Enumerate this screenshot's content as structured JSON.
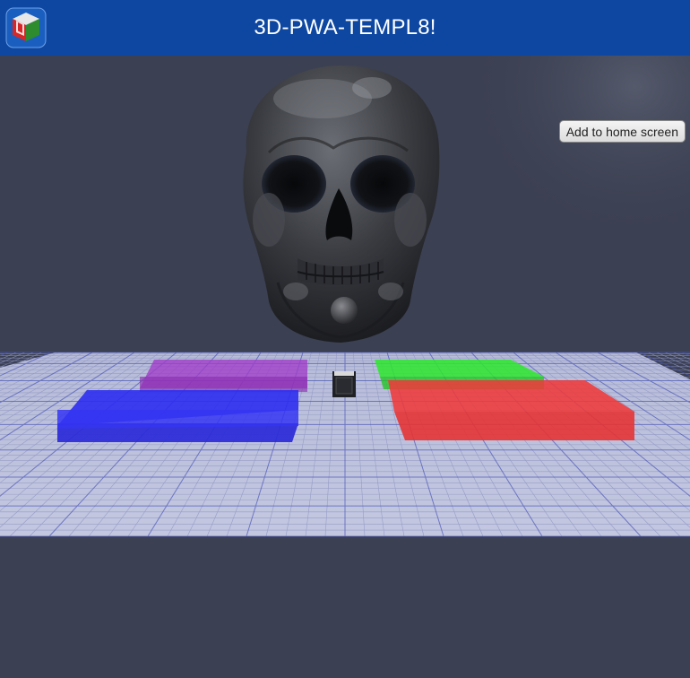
{
  "app": {
    "title": "3D-PWA-TEMPL8!",
    "logo_icon": "cube-logo-icon",
    "header_color": "#0d47a1",
    "background_color": "#3b4052"
  },
  "install": {
    "label": "Add to home screen"
  },
  "scene": {
    "objects": [
      {
        "name": "skull-model",
        "color": "#3a3c41"
      },
      {
        "name": "sphere-model",
        "color": "#4a4b50"
      },
      {
        "name": "center-cube",
        "color": "#1f2024"
      },
      {
        "name": "grid-floor",
        "color": "#bfc4e0"
      }
    ],
    "pads": [
      {
        "name": "purple-pad",
        "color": "#a03cc8"
      },
      {
        "name": "green-pad",
        "color": "#2ee82e"
      },
      {
        "name": "blue-pad",
        "color": "#2e2ef0"
      },
      {
        "name": "red-pad",
        "color": "#ee3a3a"
      }
    ]
  }
}
